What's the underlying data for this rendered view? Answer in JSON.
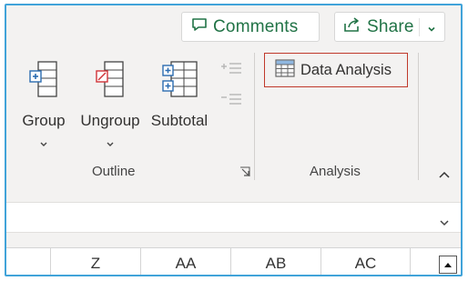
{
  "top": {
    "comments_label": "Comments",
    "share_label": "Share"
  },
  "outline": {
    "group_label": "Group",
    "ungroup_label": "Ungroup",
    "subtotal_label": "Subtotal",
    "title": "Outline"
  },
  "analysis": {
    "data_analysis_label": "Data Analysis",
    "title": "Analysis"
  },
  "columns": [
    "Z",
    "AA",
    "AB",
    "AC"
  ],
  "colors": {
    "accent_green": "#217346",
    "frame_border": "#41a3d9",
    "highlight_border": "#c0392b"
  }
}
